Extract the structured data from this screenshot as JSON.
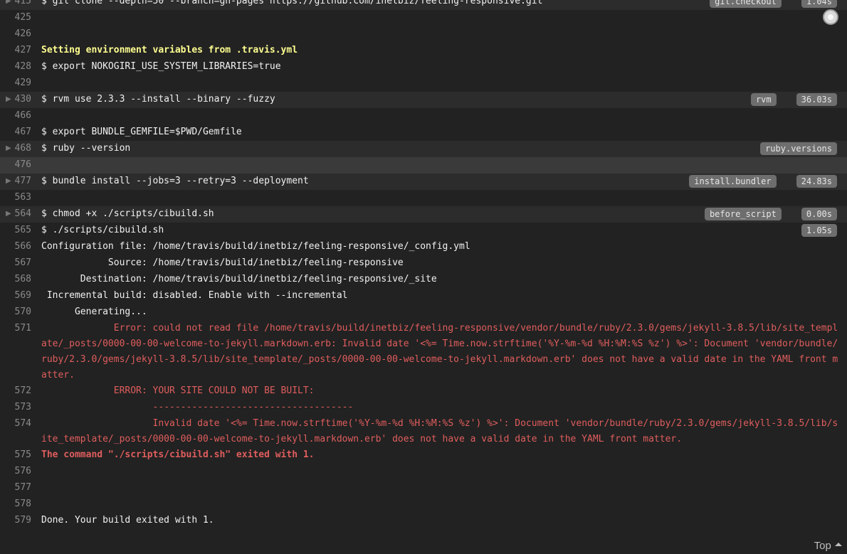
{
  "lines": [
    {
      "num": "415",
      "text": "$ git clone --depth=50 --branch=gh-pages https://github.com/inetbiz/feeling-responsive.git",
      "fold": true,
      "tag": "git.checkout",
      "time": "1.04s"
    },
    {
      "num": "425",
      "text": ""
    },
    {
      "num": "426",
      "text": ""
    },
    {
      "num": "427",
      "text": "Setting environment variables from .travis.yml",
      "style": "yellow"
    },
    {
      "num": "428",
      "text": "$ export NOKOGIRI_USE_SYSTEM_LIBRARIES=true"
    },
    {
      "num": "429",
      "text": ""
    },
    {
      "num": "430",
      "text": "$ rvm use 2.3.3 --install --binary --fuzzy",
      "fold": true,
      "tag": "rvm",
      "time": "36.03s"
    },
    {
      "num": "466",
      "text": ""
    },
    {
      "num": "467",
      "text": "$ export BUNDLE_GEMFILE=$PWD/Gemfile"
    },
    {
      "num": "468",
      "text": "$ ruby --version",
      "fold": true,
      "tag": "ruby.versions"
    },
    {
      "num": "476",
      "text": "",
      "highlight": true
    },
    {
      "num": "477",
      "text": "$ bundle install --jobs=3 --retry=3 --deployment",
      "fold": true,
      "tag": "install.bundler",
      "time": "24.83s"
    },
    {
      "num": "563",
      "text": ""
    },
    {
      "num": "564",
      "text": "$ chmod +x ./scripts/cibuild.sh",
      "fold": true,
      "tag": "before_script",
      "time": "0.00s"
    },
    {
      "num": "565",
      "text": "$ ./scripts/cibuild.sh",
      "time": "1.05s"
    },
    {
      "num": "566",
      "text": "Configuration file: /home/travis/build/inetbiz/feeling-responsive/_config.yml"
    },
    {
      "num": "567",
      "text": "            Source: /home/travis/build/inetbiz/feeling-responsive"
    },
    {
      "num": "568",
      "text": "       Destination: /home/travis/build/inetbiz/feeling-responsive/_site"
    },
    {
      "num": "569",
      "text": " Incremental build: disabled. Enable with --incremental"
    },
    {
      "num": "570",
      "text": "      Generating..."
    },
    {
      "num": "571",
      "text": "             Error: could not read file /home/travis/build/inetbiz/feeling-responsive/vendor/bundle/ruby/2.3.0/gems/jekyll-3.8.5/lib/site_template/_posts/0000-00-00-welcome-to-jekyll.markdown.erb: Invalid date '<%= Time.now.strftime('%Y-%m-%d %H:%M:%S %z') %>': Document 'vendor/bundle/ruby/2.3.0/gems/jekyll-3.8.5/lib/site_template/_posts/0000-00-00-welcome-to-jekyll.markdown.erb' does not have a valid date in the YAML front matter.",
      "style": "red"
    },
    {
      "num": "572",
      "text": "             ERROR: YOUR SITE COULD NOT BE BUILT:",
      "style": "red"
    },
    {
      "num": "573",
      "text": "                    ------------------------------------",
      "style": "red"
    },
    {
      "num": "574",
      "text": "                    Invalid date '<%= Time.now.strftime('%Y-%m-%d %H:%M:%S %z') %>': Document 'vendor/bundle/ruby/2.3.0/gems/jekyll-3.8.5/lib/site_template/_posts/0000-00-00-welcome-to-jekyll.markdown.erb' does not have a valid date in the YAML front matter.",
      "style": "red"
    },
    {
      "num": "575",
      "text": "The command \"./scripts/cibuild.sh\" exited with 1.",
      "style": "redbold"
    },
    {
      "num": "576",
      "text": ""
    },
    {
      "num": "577",
      "text": ""
    },
    {
      "num": "578",
      "text": ""
    },
    {
      "num": "579",
      "text": "Done. Your build exited with 1."
    }
  ],
  "footer": {
    "top_label": "Top"
  },
  "icons": {
    "fold": "triangle-right-icon",
    "top": "caret-up-icon",
    "scroll": "scroll-indicator-icon"
  }
}
